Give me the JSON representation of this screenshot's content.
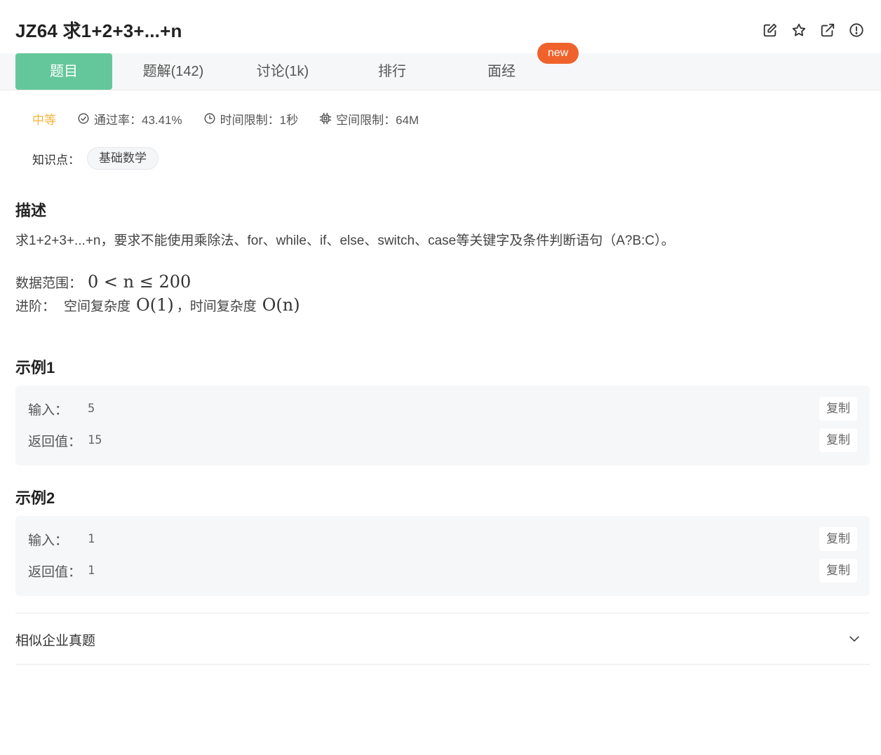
{
  "header": {
    "title": "JZ64  求1+2+3+...+n",
    "actions": [
      {
        "icon": "edit-icon",
        "label": "编辑"
      },
      {
        "icon": "star-icon",
        "label": "收藏"
      },
      {
        "icon": "external-link-icon",
        "label": "打开"
      },
      {
        "icon": "alert-icon",
        "label": "反馈"
      }
    ]
  },
  "tabs": [
    {
      "label": "题目",
      "active": true
    },
    {
      "label": "题解(142)",
      "active": false
    },
    {
      "label": "讨论(1k)",
      "active": false
    },
    {
      "label": "排行",
      "active": false
    },
    {
      "label": "面经",
      "active": false
    }
  ],
  "new_badge": "new",
  "meta": {
    "difficulty": "中等",
    "pass_rate": "通过率：43.41%",
    "time_limit": "时间限制：1秒",
    "memory_limit": "空间限制：64M"
  },
  "knowledge": {
    "label": "知识点：",
    "tag": "基础数学"
  },
  "description": {
    "heading": "描述",
    "text": "求1+2+3+...+n，要求不能使用乘除法、for、while、if、else、switch、case等关键字及条件判断语句（A?B:C）。",
    "range_label": "数据范围：",
    "range_math": "0 < n ≤ 200",
    "advanced_label": "进阶：",
    "space_label": "空间复杂度",
    "space_math": "O(1)",
    "comma": "，",
    "time_label": "时间复杂度",
    "time_math": "O(n)"
  },
  "examples": [
    {
      "heading": "示例1",
      "input_label": "输入：",
      "input_value": "5",
      "output_label": "返回值：",
      "output_value": "15",
      "copy_label": "复制"
    },
    {
      "heading": "示例2",
      "input_label": "输入：",
      "input_value": "1",
      "output_label": "返回值：",
      "output_value": "1",
      "copy_label": "复制"
    }
  ],
  "similar": {
    "label": "相似企业真题",
    "icon": "chevron-down-icon"
  },
  "colors": {
    "accent": "#64c79b",
    "badge": "#f0622c",
    "difficulty": "#f4b43b"
  }
}
